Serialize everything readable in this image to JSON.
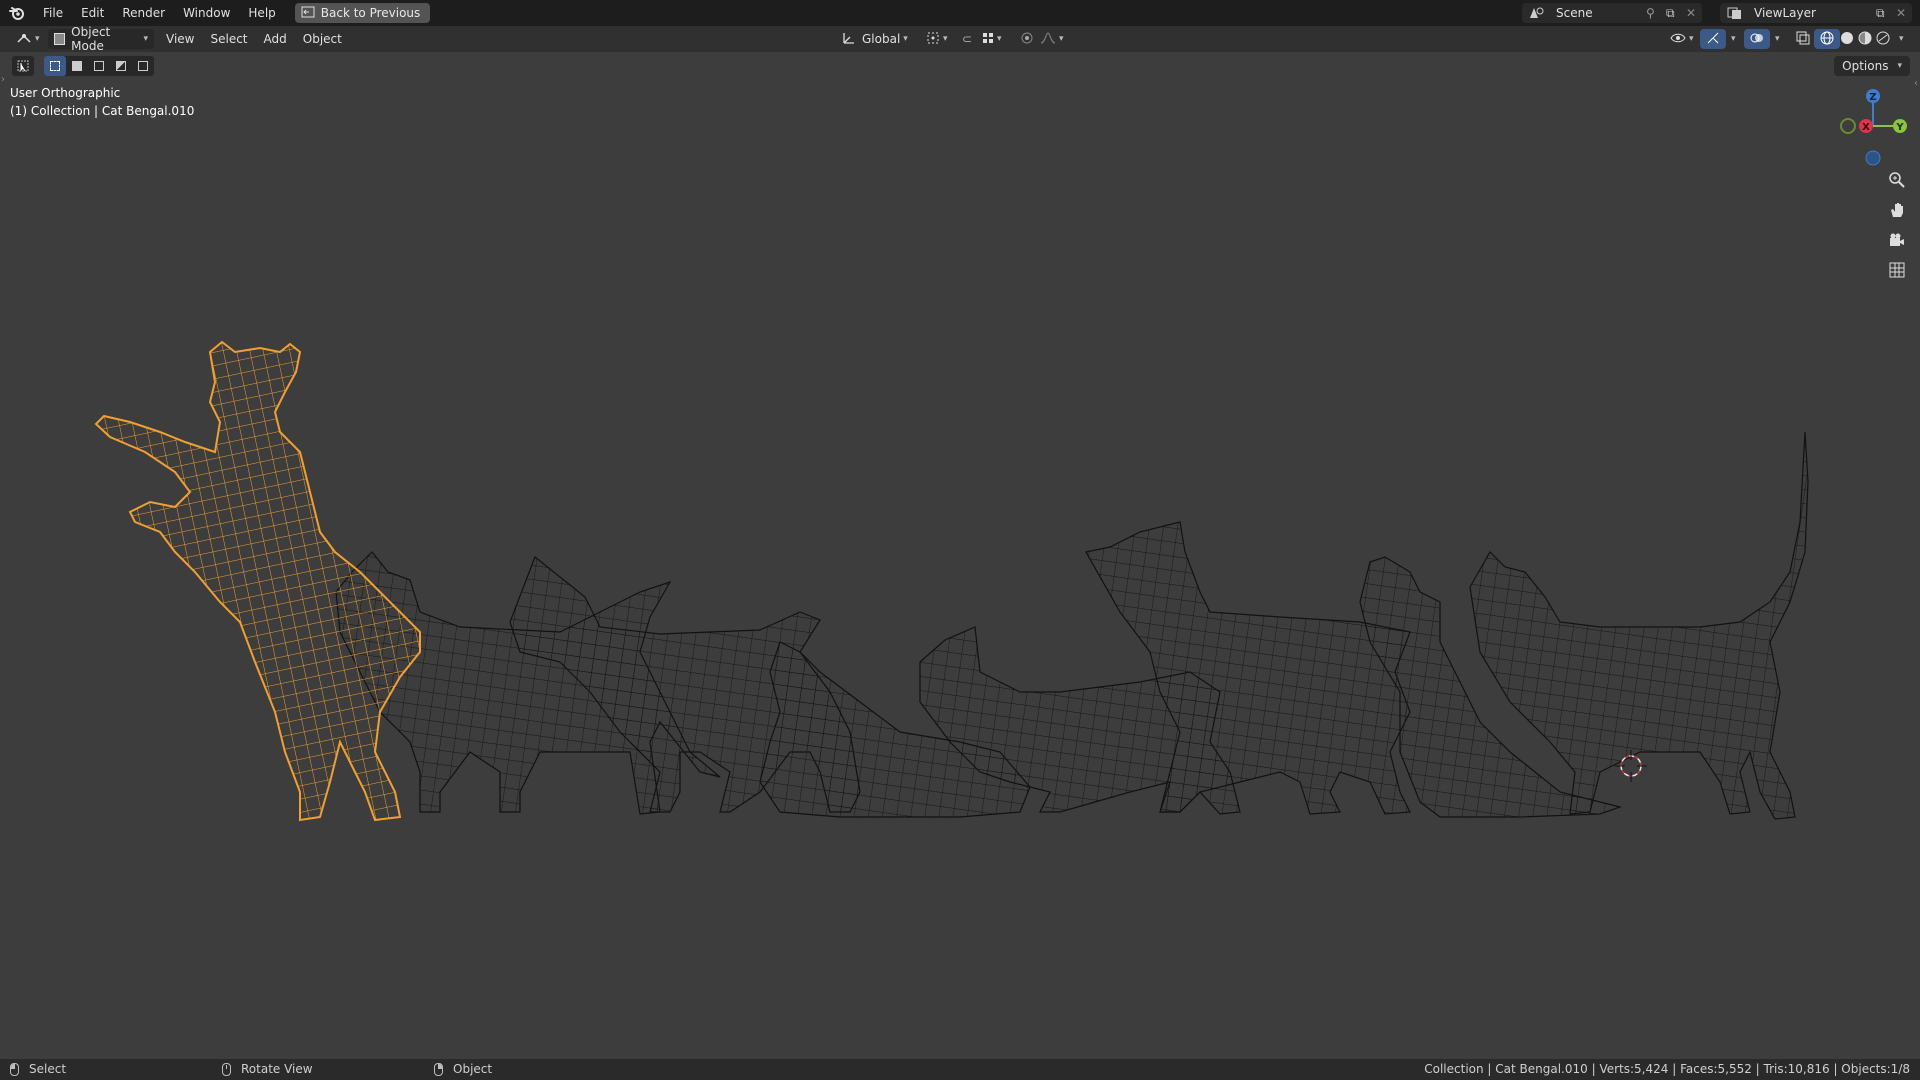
{
  "menu": {
    "items": [
      "File",
      "Edit",
      "Render",
      "Window",
      "Help"
    ],
    "back_button": "Back to Previous"
  },
  "workspace": {
    "scene": "Scene",
    "view_layer": "ViewLayer"
  },
  "header": {
    "mode": "Object Mode",
    "view": "View",
    "select": "Select",
    "add": "Add",
    "object": "Object",
    "transform_orientation": "Global",
    "options": "Options"
  },
  "viewport": {
    "view_name": "User Orthographic",
    "collection_info": "(1) Collection | Cat Bengal.010",
    "gizmo": {
      "z": "Z",
      "x": "X",
      "y": "Y"
    }
  },
  "status": {
    "select": "Select",
    "rotate": "Rotate View",
    "object": "Object",
    "stats": "Collection | Cat Bengal.010 | Verts:5,424 | Faces:5,552 | Tris:10,816 | Objects:1/8"
  },
  "colors": {
    "selected_wire": "#f0a030",
    "wire": "#111111",
    "axis_x": "#e0334a",
    "axis_y": "#8ac53a",
    "axis_z": "#3a7fd0"
  }
}
